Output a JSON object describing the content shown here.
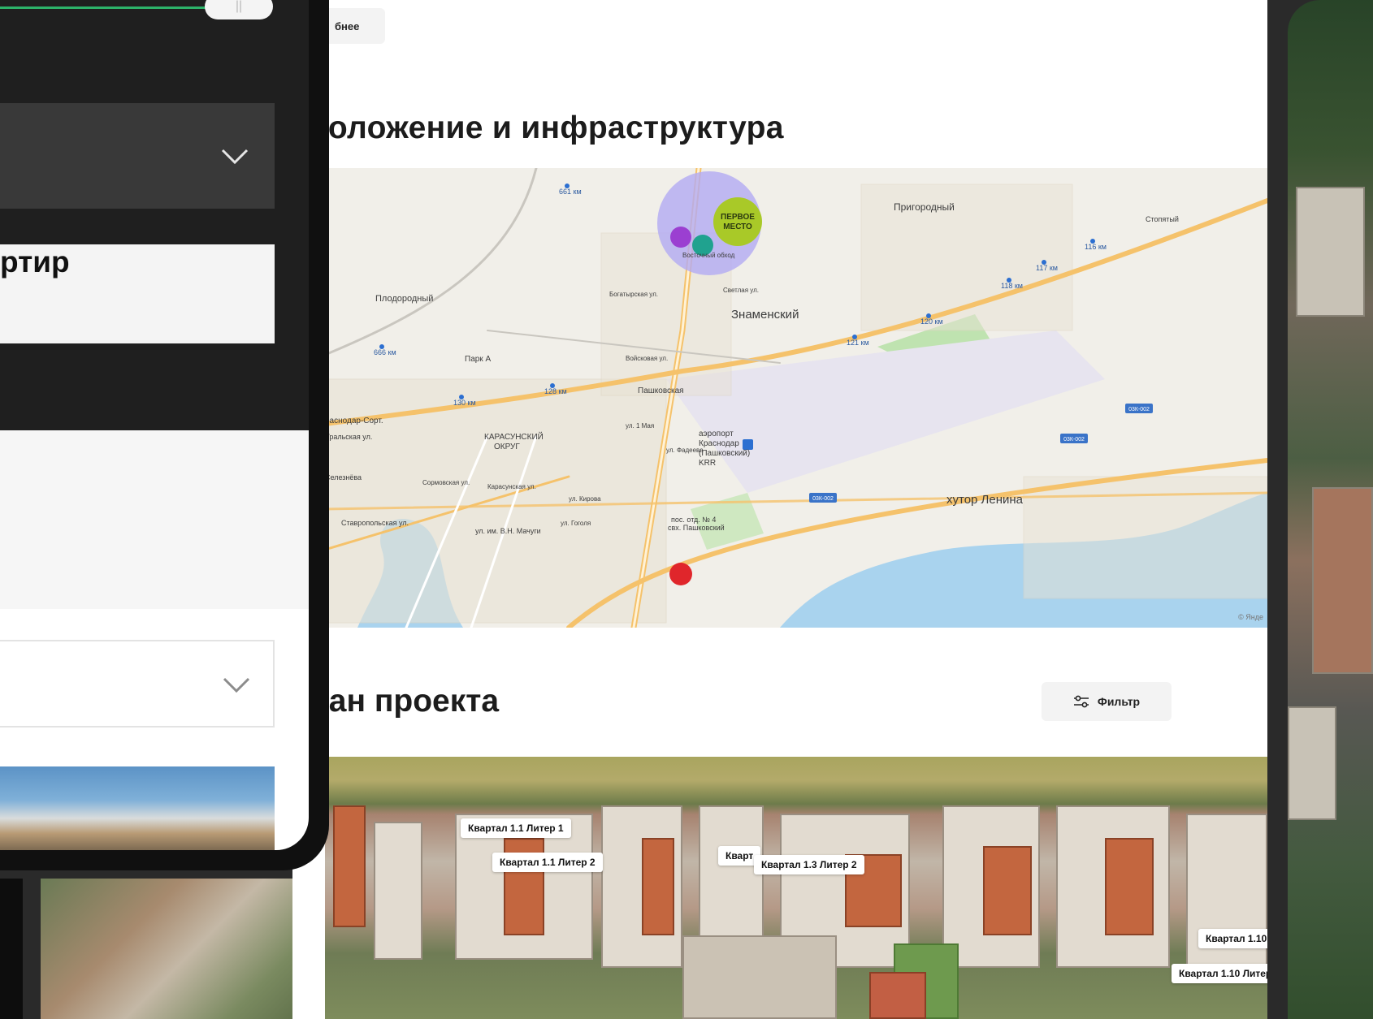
{
  "desktop": {
    "more_button": "бнее",
    "location_heading": "положение и инфраструктура",
    "plan_heading": "лан проекта",
    "filter_button": "Фильтр"
  },
  "map": {
    "logo_text_line1": "ПЕРВОЕ",
    "logo_text_line2": "МЕСТО",
    "copyright": "© Янде",
    "places": [
      {
        "text": "Пригородный"
      },
      {
        "text": "Знаменский"
      },
      {
        "text": "Плодородный"
      },
      {
        "text": "Пашковская"
      },
      {
        "text": "Парк А"
      },
      {
        "text": "хутор Ленина"
      },
      {
        "text": "аэропорт"
      },
      {
        "text": "Краснодар"
      },
      {
        "text": "(Пашковский)"
      },
      {
        "text": "KRR"
      },
      {
        "text": "КАРАСУНСКИЙ"
      },
      {
        "text": "ОКРУГ"
      },
      {
        "text": "пос. отд. № 4"
      },
      {
        "text": "свх. Пашковский"
      },
      {
        "text": "Стопятый"
      },
      {
        "text": "раснодар-Сорт."
      },
      {
        "text": "Богатырская ул."
      },
      {
        "text": "Светлая ул."
      },
      {
        "text": "Войсковая ул."
      },
      {
        "text": "Восточный обход"
      },
      {
        "text": "Уральская ул."
      },
      {
        "text": "Селезнёва"
      },
      {
        "text": "Ставропольская ул."
      },
      {
        "text": "ул. им. В.Н. Мачуги"
      },
      {
        "text": "Карасунская ул."
      },
      {
        "text": "ул. Кирова"
      },
      {
        "text": "ул. Гоголя"
      },
      {
        "text": "Сормовская ул."
      },
      {
        "text": "ул. Фадеева"
      },
      {
        "text": "ул. 1 Мая"
      }
    ],
    "km_markers": [
      "661 км",
      "666 км",
      "116 км",
      "117 км",
      "118 км",
      "120 км",
      "121 км",
      "128 км",
      "130 км"
    ],
    "road_badges": [
      "03К-002",
      "03К-002",
      "03К-002"
    ]
  },
  "plan": {
    "labels": [
      "Квартал 1.1 Литер 1",
      "Квартал 1.1 Литер 2",
      "Кварт",
      "Квартал 1.3 Литер 2",
      "Квартал 1.10",
      "Квартал 1.10 Литер"
    ]
  },
  "phone": {
    "pause_icon": "||",
    "card_text": "ртир"
  },
  "colors": {
    "progress": "#2db36a",
    "logo_green": "#a9c928",
    "logo_halo": "#b3aaf2",
    "map_bg": "#f1efe9",
    "water": "#a9d3ee",
    "road": "#f5c26b",
    "marker_red": "#e0262b",
    "marker_purple": "#9b3fd1",
    "marker_teal": "#20a28f"
  }
}
